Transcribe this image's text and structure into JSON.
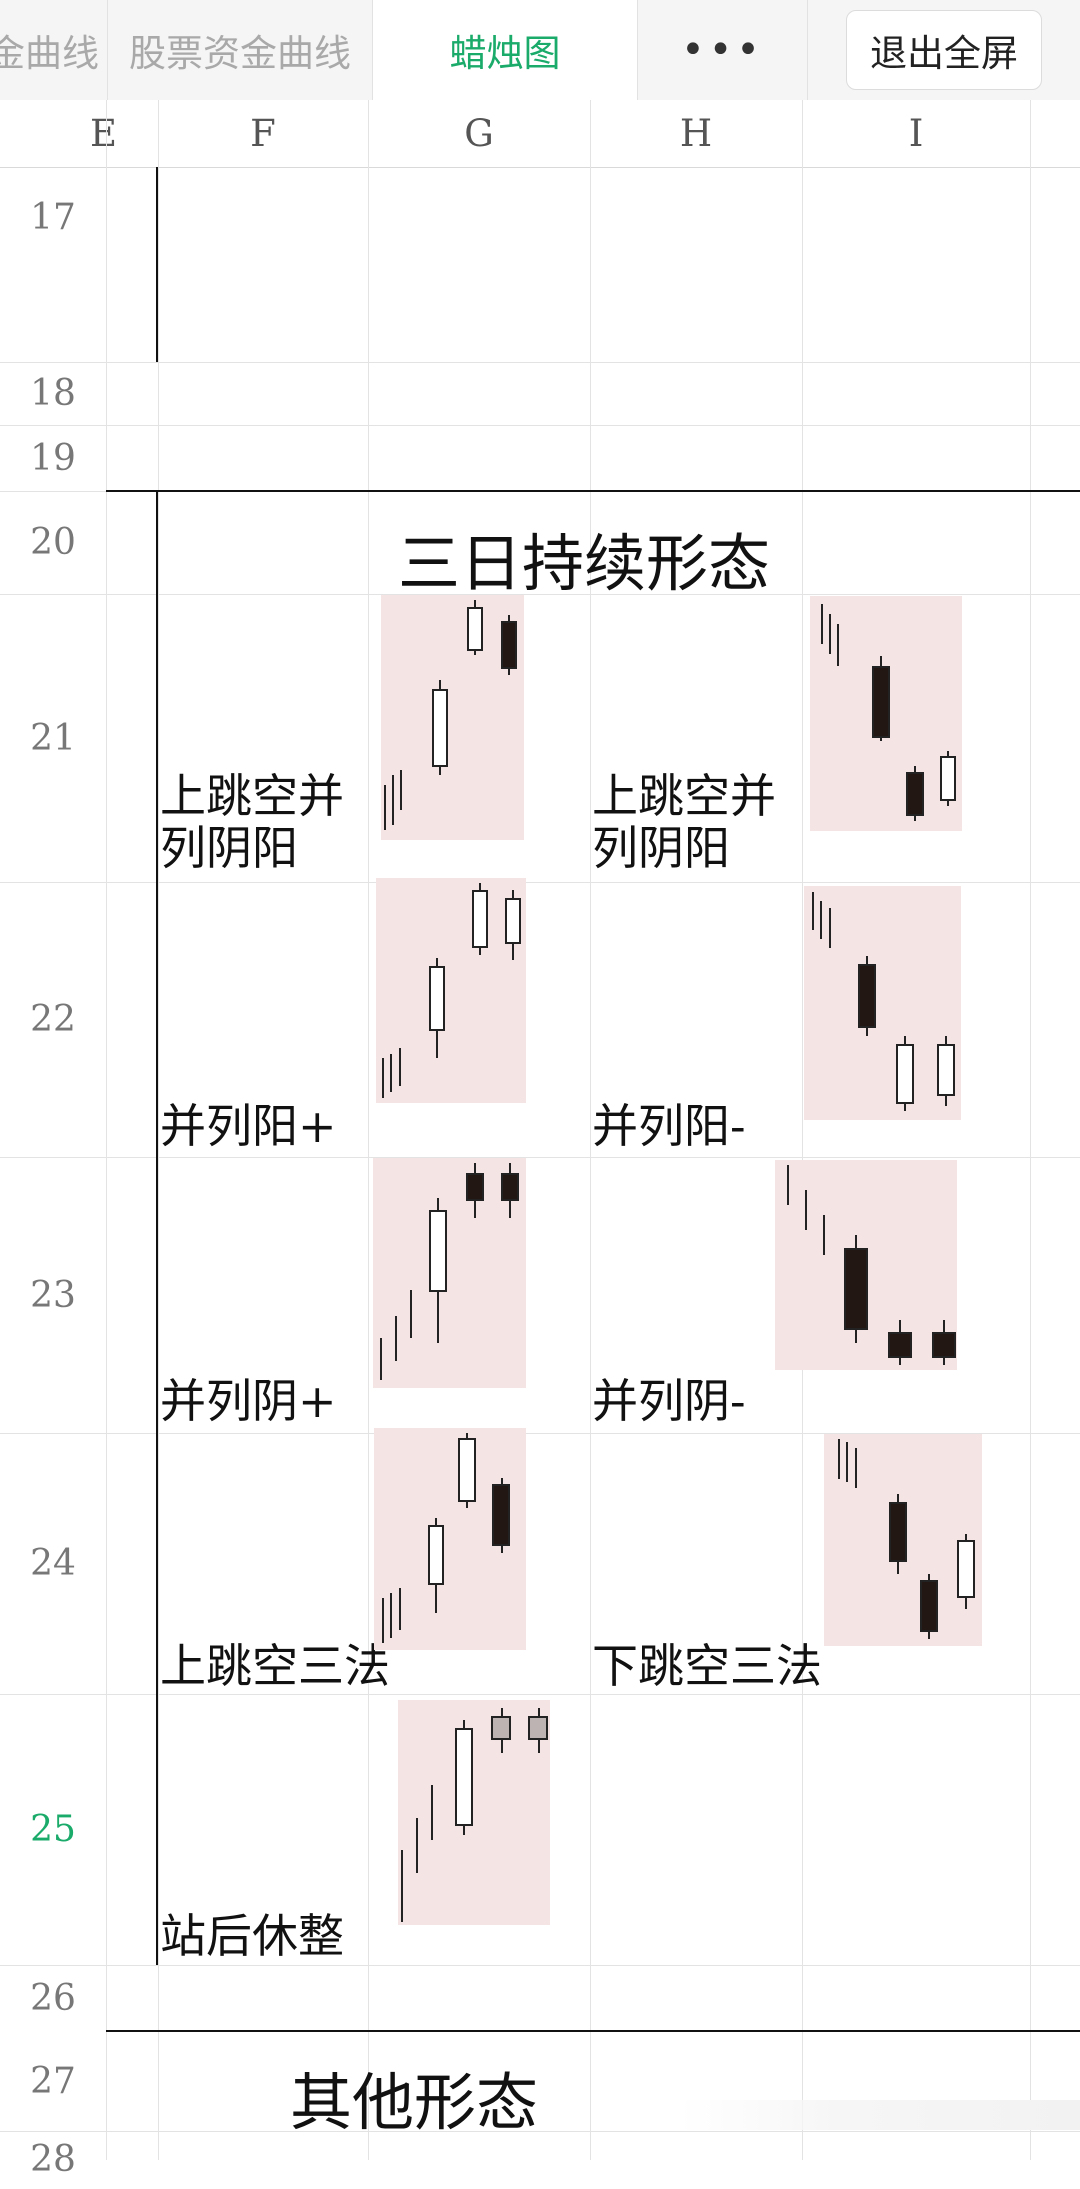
{
  "tabs": [
    {
      "label": "金曲线"
    },
    {
      "label": "股票资金曲线"
    },
    {
      "label": "蜡烛图"
    }
  ],
  "more_label": "•••",
  "exit_button": "退出全屏",
  "columns": [
    "E",
    "F",
    "G",
    "H",
    "I"
  ],
  "rows": [
    "17",
    "18",
    "19",
    "20",
    "21",
    "22",
    "23",
    "24",
    "25",
    "26",
    "27",
    "28"
  ],
  "active_row": "25",
  "section_title": "三日持续形态",
  "section_title_2": "其他形态",
  "patterns": {
    "r21_left": {
      "line1": "上跳空并",
      "line2": "列阴阳"
    },
    "r21_right": {
      "line1": "上跳空并",
      "line2": "列阴阳"
    },
    "r22_left": "并列阳+",
    "r22_right": "并列阳-",
    "r23_left": "并列阴+",
    "r23_right": "并列阴-",
    "r24_left": "上跳空三法",
    "r24_right": "下跳空三法",
    "r25_left": "站后休整"
  },
  "colors": {
    "accent": "#1aaa6a",
    "thumb_bg": "#f4e4e4",
    "candle_dark": "#231714"
  }
}
